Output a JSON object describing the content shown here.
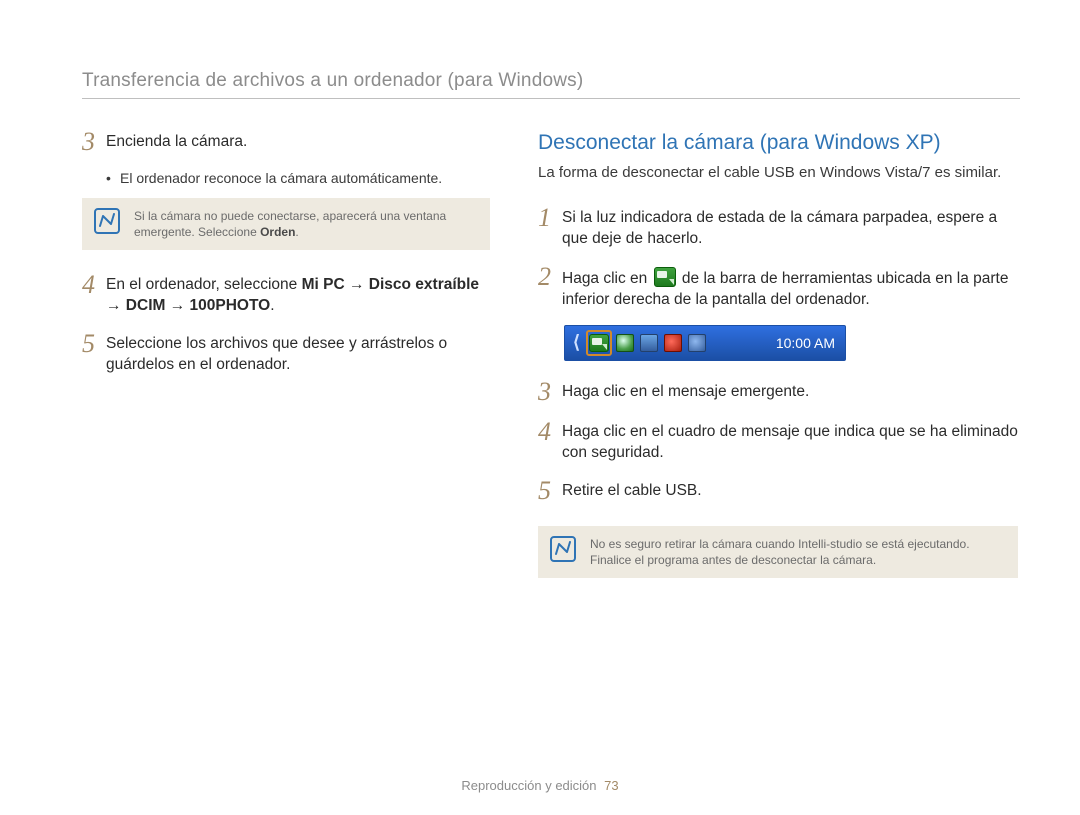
{
  "header": {
    "title": "Transferencia de archivos a un ordenador (para Windows)"
  },
  "left": {
    "step3": {
      "num": "3",
      "text": "Encienda la cámara."
    },
    "bullet1": "El ordenador reconoce la cámara automáticamente.",
    "note1_a": "Si la cámara no puede conectarse, aparecerá una ventana emergente. Seleccione ",
    "note1_b": "Orden",
    "note1_c": ".",
    "step4": {
      "num": "4",
      "pre": "En el ordenador, seleccione ",
      "bold": "Mi PC → Disco extraíble → DCIM → 100PHOTO",
      "post": "."
    },
    "step5": {
      "num": "5",
      "text": "Seleccione los archivos que desee y arrástrelos o guárdelos en el ordenador."
    }
  },
  "right": {
    "title": "Desconectar la cámara (para Windows XP)",
    "intro": "La forma de desconectar el cable USB en Windows Vista/7 es similar.",
    "step1": {
      "num": "1",
      "text": "Si la luz indicadora de estada de la cámara parpadea, espere a que deje de hacerlo."
    },
    "step2": {
      "num": "2",
      "pre": "Haga clic en ",
      "post": " de la barra de herramientas ubicada en la parte inferior derecha de la pantalla del ordenador."
    },
    "taskbar": {
      "time": "10:00 AM"
    },
    "step3": {
      "num": "3",
      "text": "Haga clic en el mensaje emergente."
    },
    "step4": {
      "num": "4",
      "text": "Haga clic en el cuadro de mensaje que indica que se ha eliminado con seguridad."
    },
    "step5": {
      "num": "5",
      "text": "Retire el cable USB."
    },
    "note2": "No es seguro retirar la cámara cuando Intelli-studio se está ejecutando. Finalice el programa antes de desconectar la cámara."
  },
  "footer": {
    "section": "Reproducción y edición",
    "page": "73"
  }
}
